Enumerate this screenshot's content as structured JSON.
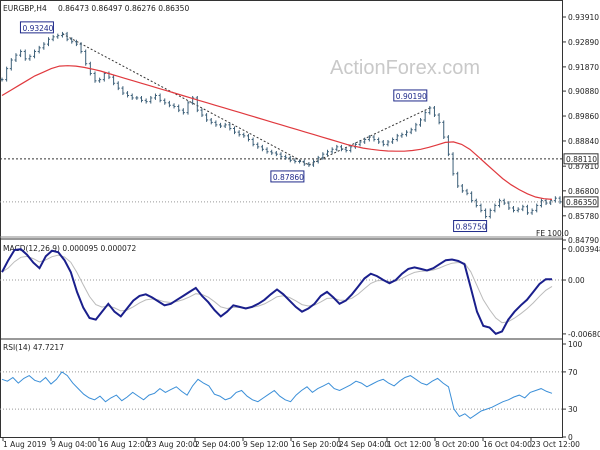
{
  "header": {
    "symbol": "EURGBP,H4",
    "ohlc": "0.86473 0.86497 0.86276 0.86350"
  },
  "watermark": "ActionForex.com",
  "fe_label": "FE 100.0",
  "chart_data": [
    {
      "type": "line",
      "name": "price",
      "x": [
        "1 Aug 2019",
        "9 Aug 04:00",
        "16 Aug 12:00",
        "23 Aug 20:00",
        "2 Sep 04:00",
        "9 Sep 12:00",
        "16 Sep 20:00",
        "24 Sep 04:00",
        "1 Oct 12:00",
        "8 Oct 20:00",
        "16 Oct 04:00",
        "23 Oct 12:00"
      ],
      "ylim": [
        0.8479,
        0.9391
      ],
      "yticks": [
        "0.93910",
        "0.92890",
        "0.91870",
        "0.90880",
        "0.89860",
        "0.88840",
        "0.87810",
        "0.86800",
        "0.85780",
        "0.84790"
      ],
      "series": [
        {
          "values": [
            0.9135,
            0.918,
            0.9215,
            0.9235,
            0.925,
            0.922,
            0.923,
            0.925,
            0.9265,
            0.928,
            0.93,
            0.931,
            0.9315,
            0.9322,
            0.93,
            0.929,
            0.928,
            0.925,
            0.92,
            0.916,
            0.913,
            0.9135,
            0.916,
            0.9145,
            0.912,
            0.91,
            0.908,
            0.907,
            0.906,
            0.906,
            0.905,
            0.9045,
            0.906,
            0.907,
            0.905,
            0.904,
            0.903,
            0.9025,
            0.901,
            0.9,
            0.904,
            0.906,
            0.901,
            0.899,
            0.897,
            0.896,
            0.895,
            0.8945,
            0.895,
            0.8935,
            0.892,
            0.891,
            0.8905,
            0.889,
            0.887,
            0.886,
            0.885,
            0.884,
            0.8835,
            0.883,
            0.882,
            0.8815,
            0.8805,
            0.88,
            0.88,
            0.879,
            0.8786,
            0.88,
            0.8815,
            0.883,
            0.884,
            0.885,
            0.886,
            0.885,
            0.8845,
            0.886,
            0.887,
            0.888,
            0.889,
            0.89,
            0.889,
            0.888,
            0.887,
            0.888,
            0.889,
            0.8905,
            0.891,
            0.892,
            0.893,
            0.895,
            0.897,
            0.9,
            0.9019,
            0.899,
            0.896,
            0.89,
            0.883,
            0.875,
            0.87,
            0.868,
            0.867,
            0.864,
            0.862,
            0.86,
            0.8575,
            0.86,
            0.862,
            0.864,
            0.863,
            0.861,
            0.86,
            0.8605,
            0.8615,
            0.859,
            0.86,
            0.862,
            0.864,
            0.863,
            0.864,
            0.865,
            0.8635
          ]
        }
      ],
      "ema_values": [
        0.907,
        0.909,
        0.911,
        0.913,
        0.915,
        0.9165,
        0.918,
        0.919,
        0.9192,
        0.919,
        0.9185,
        0.9178,
        0.917,
        0.916,
        0.915,
        0.914,
        0.913,
        0.912,
        0.911,
        0.91,
        0.909,
        0.908,
        0.907,
        0.906,
        0.905,
        0.904,
        0.903,
        0.902,
        0.901,
        0.9,
        0.899,
        0.898,
        0.897,
        0.896,
        0.895,
        0.894,
        0.893,
        0.892,
        0.891,
        0.89,
        0.889,
        0.888,
        0.887,
        0.8862,
        0.8855,
        0.885,
        0.8846,
        0.8843,
        0.8842,
        0.8842,
        0.8845,
        0.885,
        0.8858,
        0.8868,
        0.8878,
        0.888,
        0.887,
        0.885,
        0.882,
        0.879,
        0.876,
        0.873,
        0.8705,
        0.8685,
        0.8668,
        0.8655,
        0.8648,
        0.8645
      ],
      "levels": {
        "h1": 0.8811,
        "h2": 0.8635
      },
      "callouts": [
        "0.93240",
        "0.90190",
        "0.87860",
        "0.85750"
      ],
      "axis_tags": [
        "0.88110",
        "0.86350"
      ]
    },
    {
      "type": "line",
      "name": "MACD",
      "label": "MACD(12,26,9) 0.000095 0.000072",
      "ylim": [
        -0.0072,
        0.0043
      ],
      "yticks": [
        "0.003948",
        "0.00",
        "-0.006809"
      ],
      "series": [
        {
          "values": [
            0.001,
            0.0025,
            0.0038,
            0.0039,
            0.0032,
            0.0022,
            0.0015,
            0.003,
            0.0037,
            0.0035,
            0.0025,
            0.001,
            -0.0015,
            -0.0035,
            -0.0048,
            -0.005,
            -0.004,
            -0.003,
            -0.004,
            -0.0046,
            -0.0036,
            -0.0026,
            -0.002,
            -0.0018,
            -0.0022,
            -0.0027,
            -0.0032,
            -0.003,
            -0.0025,
            -0.002,
            -0.0015,
            -0.001,
            -0.002,
            -0.0028,
            -0.0038,
            -0.0046,
            -0.004,
            -0.0032,
            -0.0034,
            -0.0036,
            -0.0034,
            -0.003,
            -0.0025,
            -0.0018,
            -0.0012,
            -0.0018,
            -0.0026,
            -0.0034,
            -0.004,
            -0.0036,
            -0.003,
            -0.002,
            -0.0015,
            -0.0022,
            -0.003,
            -0.0026,
            -0.0018,
            -0.0008,
            0.0002,
            0.0008,
            0.0005,
            0.0,
            -0.0004,
            0.0,
            0.0008,
            0.0014,
            0.0016,
            0.0014,
            0.0012,
            0.0015,
            0.002,
            0.0025,
            0.0026,
            0.0024,
            0.002,
            -0.001,
            -0.004,
            -0.0058,
            -0.006,
            -0.0068,
            -0.0065,
            -0.005,
            -0.004,
            -0.0032,
            -0.0025,
            -0.0015,
            -0.0005,
            0.0001,
            0.0001
          ]
        }
      ]
    },
    {
      "type": "line",
      "name": "RSI",
      "label": "RSI(14) 47.7217",
      "ylim": [
        0,
        100
      ],
      "yticks": [
        "100",
        "70",
        "30",
        "0"
      ],
      "series": [
        {
          "values": [
            62,
            60,
            64,
            58,
            63,
            66,
            61,
            59,
            64,
            57,
            62,
            70,
            66,
            58,
            52,
            46,
            42,
            40,
            44,
            38,
            42,
            45,
            39,
            43,
            48,
            44,
            40,
            45,
            47,
            52,
            48,
            51,
            54,
            49,
            45,
            55,
            62,
            58,
            55,
            46,
            44,
            40,
            42,
            48,
            50,
            44,
            40,
            38,
            42,
            46,
            50,
            44,
            40,
            38,
            45,
            50,
            54,
            48,
            52,
            55,
            58,
            52,
            50,
            53,
            56,
            60,
            58,
            54,
            57,
            60,
            62,
            58,
            55,
            60,
            64,
            66,
            62,
            58,
            56,
            60,
            63,
            58,
            54,
            30,
            22,
            25,
            20,
            24,
            28,
            30,
            32,
            35,
            38,
            40,
            43,
            45,
            42,
            48,
            50,
            52,
            49,
            47
          ]
        }
      ]
    }
  ],
  "xaxis_labels": [
    "1 Aug 2019",
    "9 Aug 04:00",
    "16 Aug 12:00",
    "23 Aug 20:00",
    "2 Sep 04:00",
    "9 Sep 12:00",
    "16 Sep 20:00",
    "24 Sep 04:00",
    "1 Oct 12:00",
    "8 Oct 20:00",
    "16 Oct 04:00",
    "23 Oct 12:00"
  ]
}
